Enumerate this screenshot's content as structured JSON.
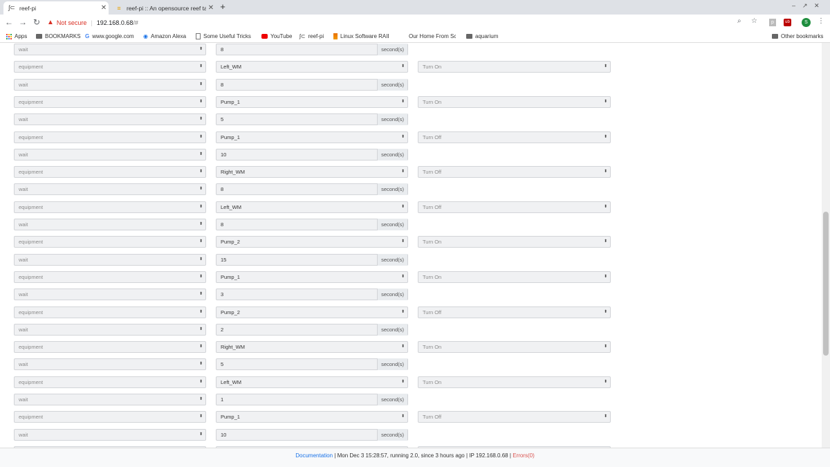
{
  "browser": {
    "tabs": [
      {
        "title": "reef-pi",
        "active": true
      },
      {
        "title": "reef-pi :: An opensource reef ta",
        "active": false
      }
    ],
    "not_secure": "Not secure",
    "url_host": "192.168.0.68",
    "url_path": "/#",
    "bookmarks": [
      "Apps",
      "BOOKMARKS",
      "www.google.com",
      "Amazon Alexa",
      "Some Useful Tricks",
      "YouTube",
      "reef-pi",
      "Linux Software RAID",
      "Our Home From Scr",
      "aquarium"
    ],
    "other_bookmarks": "Other bookmarks",
    "avatar_letter": "S"
  },
  "unit_label": "second(s)",
  "steps": [
    {
      "type": "wait",
      "value": "8"
    },
    {
      "type": "equipment",
      "equipment": "Left_WM",
      "action": "Turn On"
    },
    {
      "type": "wait",
      "value": "8"
    },
    {
      "type": "equipment",
      "equipment": "Pump_1",
      "action": "Turn On"
    },
    {
      "type": "wait",
      "value": "5"
    },
    {
      "type": "equipment",
      "equipment": "Pump_1",
      "action": "Turn Off"
    },
    {
      "type": "wait",
      "value": "10"
    },
    {
      "type": "equipment",
      "equipment": "Right_WM",
      "action": "Turn Off"
    },
    {
      "type": "wait",
      "value": "8"
    },
    {
      "type": "equipment",
      "equipment": "Left_WM",
      "action": "Turn Off"
    },
    {
      "type": "wait",
      "value": "8"
    },
    {
      "type": "equipment",
      "equipment": "Pump_2",
      "action": "Turn On"
    },
    {
      "type": "wait",
      "value": "15"
    },
    {
      "type": "equipment",
      "equipment": "Pump_1",
      "action": "Turn On"
    },
    {
      "type": "wait",
      "value": "3"
    },
    {
      "type": "equipment",
      "equipment": "Pump_2",
      "action": "Turn Off"
    },
    {
      "type": "wait",
      "value": "2"
    },
    {
      "type": "equipment",
      "equipment": "Right_WM",
      "action": "Turn On"
    },
    {
      "type": "wait",
      "value": "5"
    },
    {
      "type": "equipment",
      "equipment": "Left_WM",
      "action": "Turn On"
    },
    {
      "type": "wait",
      "value": "1"
    },
    {
      "type": "equipment",
      "equipment": "Pump_1",
      "action": "Turn Off"
    },
    {
      "type": "wait",
      "value": "10"
    },
    {
      "type": "equipment",
      "equipment": "",
      "action": ""
    }
  ],
  "footer": {
    "documentation": "Documentation",
    "divider": "|",
    "status": "Mon Dec 3 15:28:57,  running 2.0,  since 3 hours ago",
    "ip": "IP 192.168.0.68",
    "errors": "Errors(0)"
  }
}
